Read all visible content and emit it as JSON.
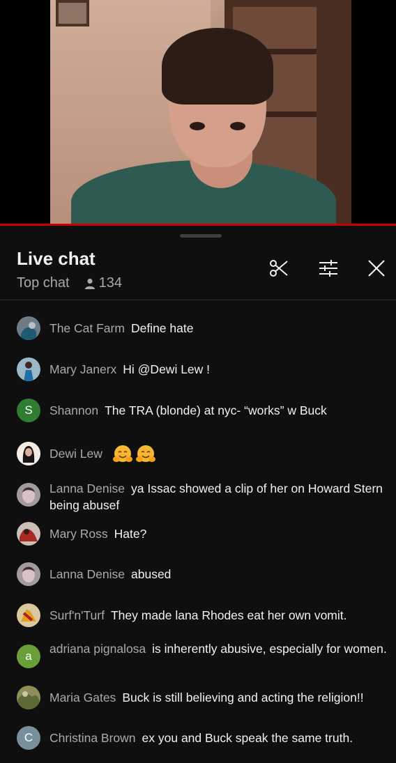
{
  "video": {
    "description_icon": "video-frame"
  },
  "chat": {
    "title": "Live chat",
    "mode": "Top chat",
    "viewer_count": "134",
    "icons": {
      "clip": "scissors-icon",
      "filter": "sliders-icon",
      "close": "close-icon"
    }
  },
  "messages": [
    {
      "author": "The Cat Farm",
      "text": "Define hate",
      "avatar_color": "#5a6b7a",
      "avatar_letter": ""
    },
    {
      "author": "Mary Janerx",
      "text": "Hi @Dewi Lew !",
      "avatar_color": "#3b6f8f",
      "avatar_letter": ""
    },
    {
      "author": "Shannon",
      "text": "The TRA (blonde) at nyc- “works” w Buck",
      "avatar_color": "#2e7d32",
      "avatar_letter": "S"
    },
    {
      "author": "Dewi Lew",
      "text": "",
      "emoji": [
        "hugging-face-emoji",
        "hugging-face-emoji"
      ],
      "avatar_color": "#e8e0d8",
      "avatar_letter": ""
    },
    {
      "author": "Lanna Denise",
      "text": "ya Issac showed a clip of her on Howard Stern being abusef",
      "avatar_color": "#8a7f86",
      "avatar_letter": ""
    },
    {
      "author": "Mary Ross",
      "text": "Hate?",
      "avatar_color": "#8b2f2a",
      "avatar_letter": ""
    },
    {
      "author": "Lanna Denise",
      "text": "abused",
      "avatar_color": "#8a7f86",
      "avatar_letter": ""
    },
    {
      "author": "Surf'n'Turf",
      "text": "They made lana Rhodes eat her own vomit.",
      "avatar_color": "#c2552a",
      "avatar_letter": ""
    },
    {
      "author": "adriana pignalosa",
      "text": "is inherently abusive, especially for women.",
      "avatar_color": "#689f38",
      "avatar_letter": "a"
    },
    {
      "author": "Maria Gates",
      "text": "Buck is still believing and acting the religion!!",
      "avatar_color": "#7a7a4a",
      "avatar_letter": ""
    },
    {
      "author": "Christina Brown",
      "text": "ex you and Buck speak the same truth.",
      "avatar_color": "#78909c",
      "avatar_letter": "C"
    }
  ]
}
